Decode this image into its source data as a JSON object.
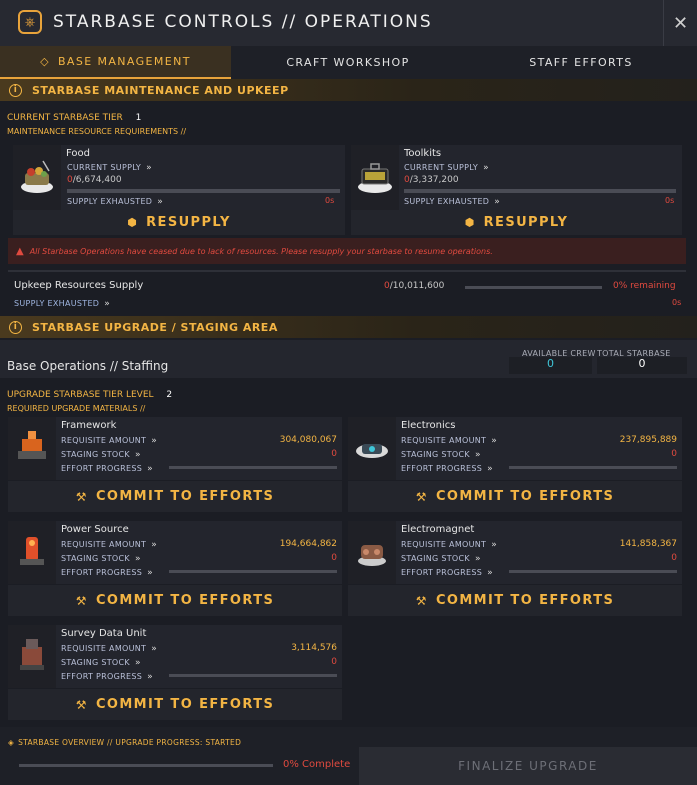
{
  "window": {
    "title": "STARBASE CONTROLS // OPERATIONS",
    "close": "✕"
  },
  "tabs": [
    {
      "label": "BASE MANAGEMENT",
      "active": true
    },
    {
      "label": "CRAFT WORKSHOP",
      "active": false
    },
    {
      "label": "STAFF EFFORTS",
      "active": false
    }
  ],
  "maintenance": {
    "header": "STARBASE MAINTENANCE AND UPKEEP",
    "tier_label": "CURRENT STARBASE TIER",
    "tier_value": "1",
    "req_label": "MAINTENANCE RESOURCE REQUIREMENTS //",
    "resources": [
      {
        "name": "Food",
        "supply_label": "CURRENT SUPPLY",
        "current": "0",
        "total": "/6,674,400",
        "status": "SUPPLY EXHAUSTED",
        "time": "0s",
        "button": "RESUPPLY",
        "progress": 0
      },
      {
        "name": "Toolkits",
        "supply_label": "CURRENT SUPPLY",
        "current": "0",
        "total": "/3,337,200",
        "status": "SUPPLY EXHAUSTED",
        "time": "0s",
        "button": "RESUPPLY",
        "progress": 0
      }
    ],
    "warning": "All Starbase Operations have ceased due to lack of resources. Please resupply your starbase to resume operations.",
    "upkeep": {
      "label": "Upkeep Resources Supply",
      "current": "0",
      "total": "/10,011,600",
      "remaining": "0% remaining",
      "status": "SUPPLY EXHAUSTED",
      "time": "0s",
      "progress": 0
    }
  },
  "upgrade": {
    "header": "STARBASE UPGRADE / STAGING AREA",
    "staffing_label": "Base Operations // Staffing",
    "available_crew_label": "AVAILABLE CREW",
    "available_crew": "0",
    "total_crew_label": "TOTAL STARBASE CREW",
    "total_crew": "0",
    "tier_label": "UPGRADE STARBASE TIER LEVEL",
    "tier_value": "2",
    "req_label": "REQUIRED UPGRADE MATERIALS //",
    "row_labels": {
      "requisite": "REQUISITE AMOUNT",
      "staging": "STAGING STOCK",
      "effort": "EFFORT PROGRESS"
    },
    "commit_label": "COMMIT TO EFFORTS",
    "materials": [
      {
        "name": "Framework",
        "requisite": "304,080,067",
        "staging": "0",
        "progress": 0
      },
      {
        "name": "Electronics",
        "requisite": "237,895,889",
        "staging": "0",
        "progress": 0
      },
      {
        "name": "Power Source",
        "requisite": "194,664,862",
        "staging": "0",
        "progress": 0
      },
      {
        "name": "Electromagnet",
        "requisite": "141,858,367",
        "staging": "0",
        "progress": 0
      },
      {
        "name": "Survey Data Unit",
        "requisite": "3,114,576",
        "staging": "0",
        "progress": 0
      }
    ]
  },
  "footer": {
    "overview": "STARBASE OVERVIEW // UPGRADE PROGRESS: STARTED",
    "complete": "0% Complete",
    "progress": 0,
    "finalize": "FINALIZE UPGRADE"
  },
  "colors": {
    "accent": "#f3b544",
    "alert": "#e04a3f",
    "cyan": "#3fc6d8"
  }
}
